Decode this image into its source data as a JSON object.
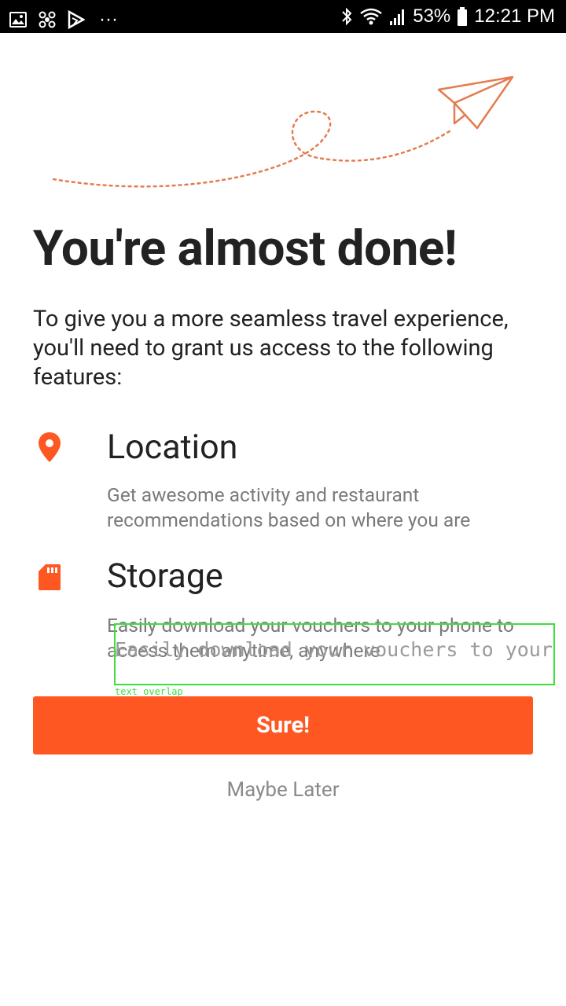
{
  "status_bar": {
    "battery_percent": "53%",
    "time": "12:21 PM",
    "more_indicator": "···"
  },
  "onboarding": {
    "title": "You're almost done!",
    "intro": "To give you a more seamless travel experience, you'll need to grant us access to the following features:",
    "features": [
      {
        "icon": "location-pin-icon",
        "title": "Location",
        "description": "Get awesome activity and restaurant recommendations based on where you are"
      },
      {
        "icon": "sd-card-icon",
        "title": "Storage",
        "description": "Easily download your vouchers to your phone to access them anytime, anywhere"
      }
    ],
    "overlap_text": "Easily download your vouchers to your phone",
    "overlap_label": "text overlap",
    "primary_button": "Sure!",
    "secondary_button": "Maybe Later"
  },
  "colors": {
    "accent": "#ff5722",
    "illustration": "#e57b4f",
    "title_text": "#222222",
    "muted_text": "#7a7a7a",
    "overlay_green": "#3de03d"
  }
}
